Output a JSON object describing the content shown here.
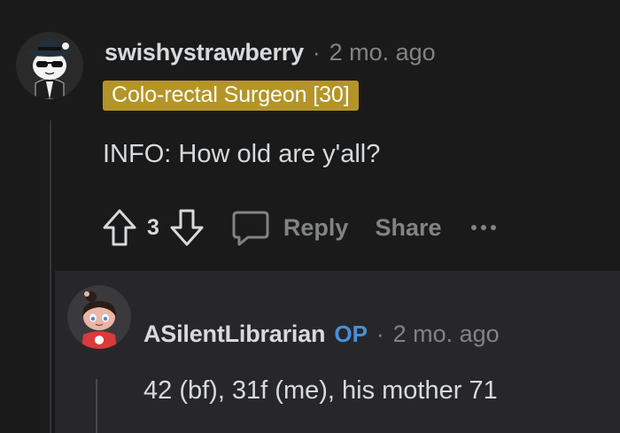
{
  "parent_comment": {
    "username": "swishystrawberry",
    "separator": "·",
    "timestamp": "2 mo. ago",
    "flair": "Colo-rectal Surgeon [30]",
    "body": "INFO: How old are y'all?",
    "score": "3",
    "reply_label": "Reply",
    "share_label": "Share",
    "flair_color": "#b59427"
  },
  "child_comment": {
    "username": "ASilentLibrarian",
    "op_badge": "OP",
    "separator": "·",
    "timestamp": "2 mo. ago",
    "body": "42 (bf), 31f (me), his mother 71",
    "op_color": "#4a8ed8"
  }
}
